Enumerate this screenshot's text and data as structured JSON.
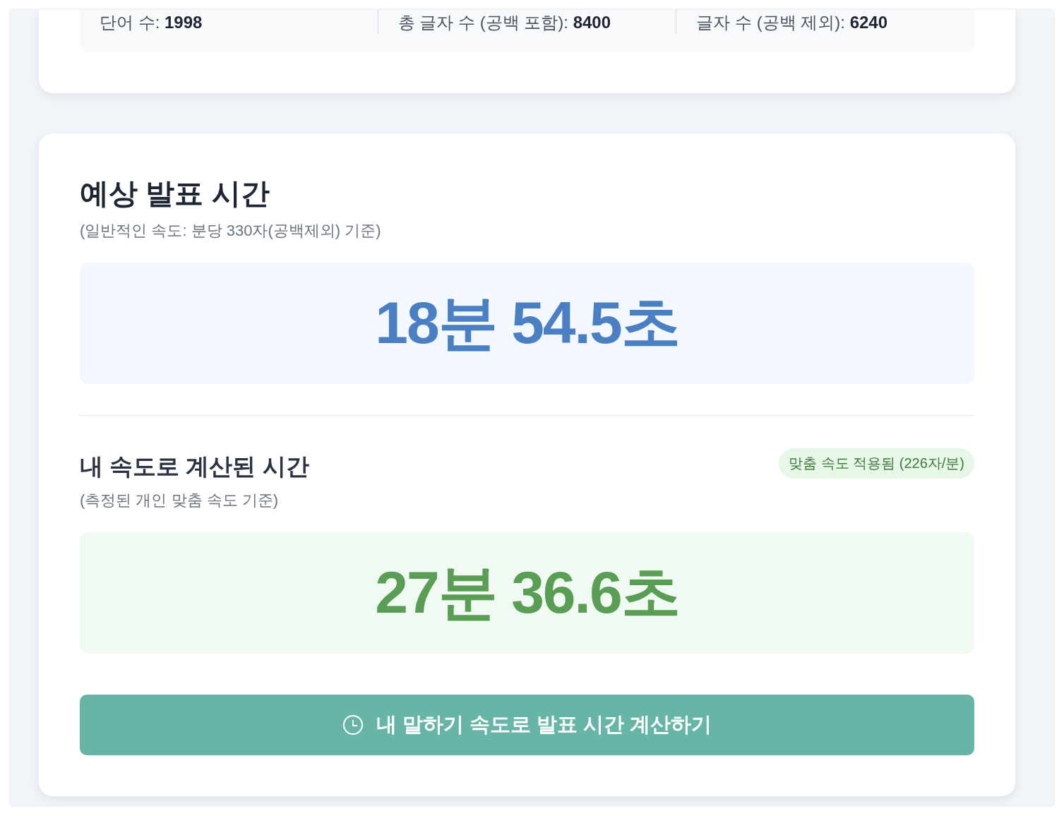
{
  "stats": [
    {
      "label": "단어 수:",
      "value": "1998"
    },
    {
      "label": "총 글자 수 (공백 포함):",
      "value": "8400"
    },
    {
      "label": "글자 수 (공백 제외):",
      "value": "6240"
    }
  ],
  "estimate": {
    "title": "예상 발표 시간",
    "subtitle": "(일반적인 속도: 분당 330자(공백제외) 기준)",
    "time": "18분 54.5초"
  },
  "custom": {
    "title": "내 속도로 계산된 시간",
    "subtitle": "(측정된 개인 맞춤 속도 기준)",
    "badge": "맞춤 속도 적용됨 (226자/분)",
    "time": "27분 36.6초"
  },
  "button": {
    "label": "내 말하기 속도로 발표 시간 계산하기"
  }
}
